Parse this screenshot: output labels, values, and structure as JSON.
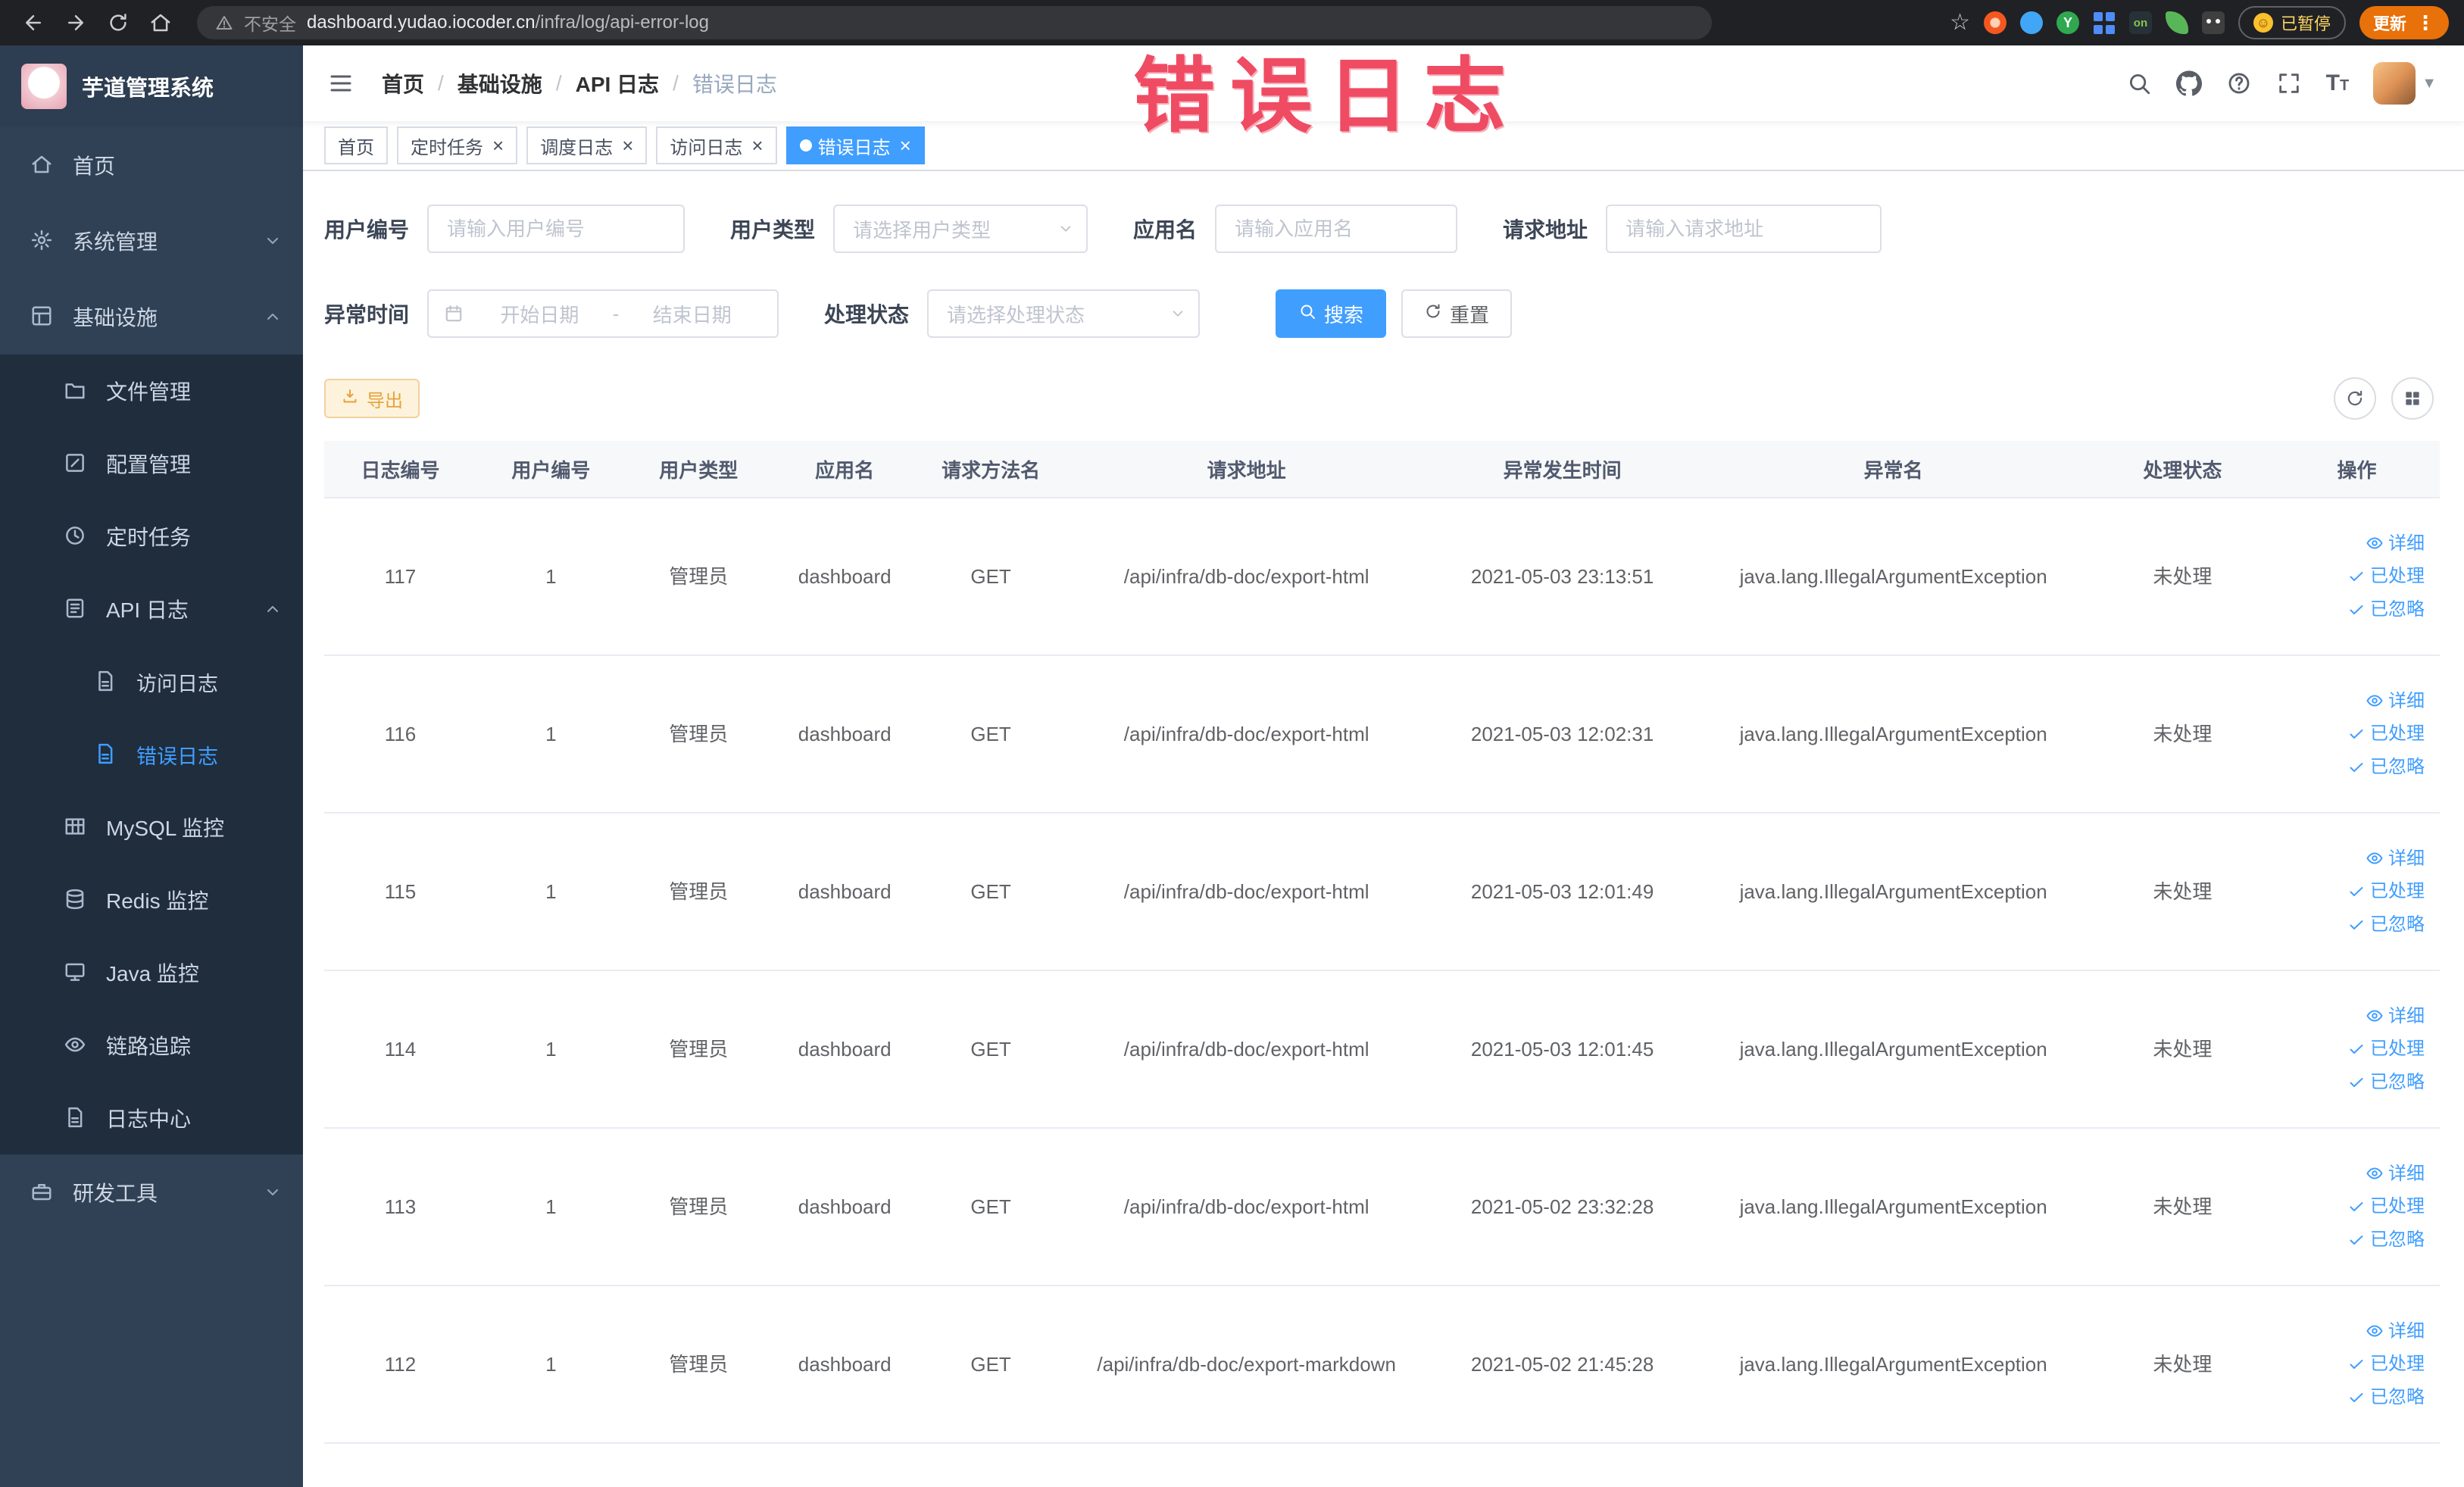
{
  "colors": {
    "accent": "#409EFF",
    "sidebar_bg": "#304156",
    "submenu_bg": "#1f2d3d",
    "warning": "#e6a23c",
    "annotation": "#ef4b63"
  },
  "browser": {
    "security_label": "不安全",
    "url_host": "dashboard.yudao.iocoder.cn",
    "url_path": "/infra/log/api-error-log",
    "ext_on_label": "on",
    "ext_y_label": "Y",
    "profile_chip_label": "已暂停",
    "update_label": "更新"
  },
  "annotation": {
    "text": "错误日志"
  },
  "sidebar": {
    "logo_title": "芋道管理系统",
    "items": [
      {
        "label": "首页",
        "icon": "home",
        "level": 0
      },
      {
        "label": "系统管理",
        "icon": "gear",
        "level": 0,
        "chevron": "down"
      },
      {
        "label": "基础设施",
        "icon": "infra",
        "level": 0,
        "chevron": "up"
      },
      {
        "label": "文件管理",
        "icon": "folder",
        "level": 1,
        "sub": true
      },
      {
        "label": "配置管理",
        "icon": "edit",
        "level": 1,
        "sub": true
      },
      {
        "label": "定时任务",
        "icon": "job",
        "level": 1,
        "sub": true
      },
      {
        "label": "API 日志",
        "icon": "logdoc",
        "level": 1,
        "sub": true,
        "chevron": "up"
      },
      {
        "label": "访问日志",
        "icon": "doc",
        "level": 2,
        "sub": true
      },
      {
        "label": "错误日志",
        "icon": "doc",
        "level": 2,
        "sub": true,
        "active": true
      },
      {
        "label": "MySQL 监控",
        "icon": "tableic",
        "level": 1,
        "sub": true
      },
      {
        "label": "Redis 监控",
        "icon": "db",
        "level": 1,
        "sub": true
      },
      {
        "label": "Java 监控",
        "icon": "monitor",
        "level": 1,
        "sub": true
      },
      {
        "label": "链路追踪",
        "icon": "eye",
        "level": 1,
        "sub": true
      },
      {
        "label": "日志中心",
        "icon": "doc",
        "level": 1,
        "sub": true
      },
      {
        "label": "研发工具",
        "icon": "tools",
        "level": 0,
        "chevron": "down"
      }
    ]
  },
  "header": {
    "breadcrumb": [
      "首页",
      "基础设施",
      "API 日志",
      "错误日志"
    ],
    "separator": "/"
  },
  "tags": [
    {
      "label": "首页",
      "closable": false,
      "active": false
    },
    {
      "label": "定时任务",
      "closable": true,
      "active": false
    },
    {
      "label": "调度日志",
      "closable": true,
      "active": false
    },
    {
      "label": "访问日志",
      "closable": true,
      "active": false
    },
    {
      "label": "错误日志",
      "closable": true,
      "active": true
    }
  ],
  "filters": {
    "user_id": {
      "label": "用户编号",
      "placeholder": "请输入用户编号"
    },
    "user_type": {
      "label": "用户类型",
      "placeholder": "请选择用户类型"
    },
    "app_name": {
      "label": "应用名",
      "placeholder": "请输入应用名"
    },
    "request_url": {
      "label": "请求地址",
      "placeholder": "请输入请求地址"
    },
    "exception_time": {
      "label": "异常时间",
      "start_placeholder": "开始日期",
      "separator": "-",
      "end_placeholder": "结束日期"
    },
    "process_status": {
      "label": "处理状态",
      "placeholder": "请选择处理状态"
    },
    "search_label": "搜索",
    "reset_label": "重置"
  },
  "toolbar": {
    "export_label": "导出"
  },
  "table": {
    "columns": [
      "日志编号",
      "用户编号",
      "用户类型",
      "应用名",
      "请求方法名",
      "请求地址",
      "异常发生时间",
      "异常名",
      "处理状态",
      "操作"
    ],
    "actions": [
      "详细",
      "已处理",
      "已忽略"
    ],
    "rows": [
      {
        "id": "117",
        "user_id": "1",
        "user_type": "管理员",
        "app": "dashboard",
        "method": "GET",
        "url": "/api/infra/db-doc/export-html",
        "time": "2021-05-03 23:13:51",
        "exception": "java.lang.IllegalArgumentException",
        "status": "未处理"
      },
      {
        "id": "116",
        "user_id": "1",
        "user_type": "管理员",
        "app": "dashboard",
        "method": "GET",
        "url": "/api/infra/db-doc/export-html",
        "time": "2021-05-03 12:02:31",
        "exception": "java.lang.IllegalArgumentException",
        "status": "未处理"
      },
      {
        "id": "115",
        "user_id": "1",
        "user_type": "管理员",
        "app": "dashboard",
        "method": "GET",
        "url": "/api/infra/db-doc/export-html",
        "time": "2021-05-03 12:01:49",
        "exception": "java.lang.IllegalArgumentException",
        "status": "未处理"
      },
      {
        "id": "114",
        "user_id": "1",
        "user_type": "管理员",
        "app": "dashboard",
        "method": "GET",
        "url": "/api/infra/db-doc/export-html",
        "time": "2021-05-03 12:01:45",
        "exception": "java.lang.IllegalArgumentException",
        "status": "未处理"
      },
      {
        "id": "113",
        "user_id": "1",
        "user_type": "管理员",
        "app": "dashboard",
        "method": "GET",
        "url": "/api/infra/db-doc/export-html",
        "time": "2021-05-02 23:32:28",
        "exception": "java.lang.IllegalArgumentException",
        "status": "未处理"
      },
      {
        "id": "112",
        "user_id": "1",
        "user_type": "管理员",
        "app": "dashboard",
        "method": "GET",
        "url": "/api/infra/db-doc/export-markdown",
        "time": "2021-05-02 21:45:28",
        "exception": "java.lang.IllegalArgumentException",
        "status": "未处理"
      }
    ]
  }
}
